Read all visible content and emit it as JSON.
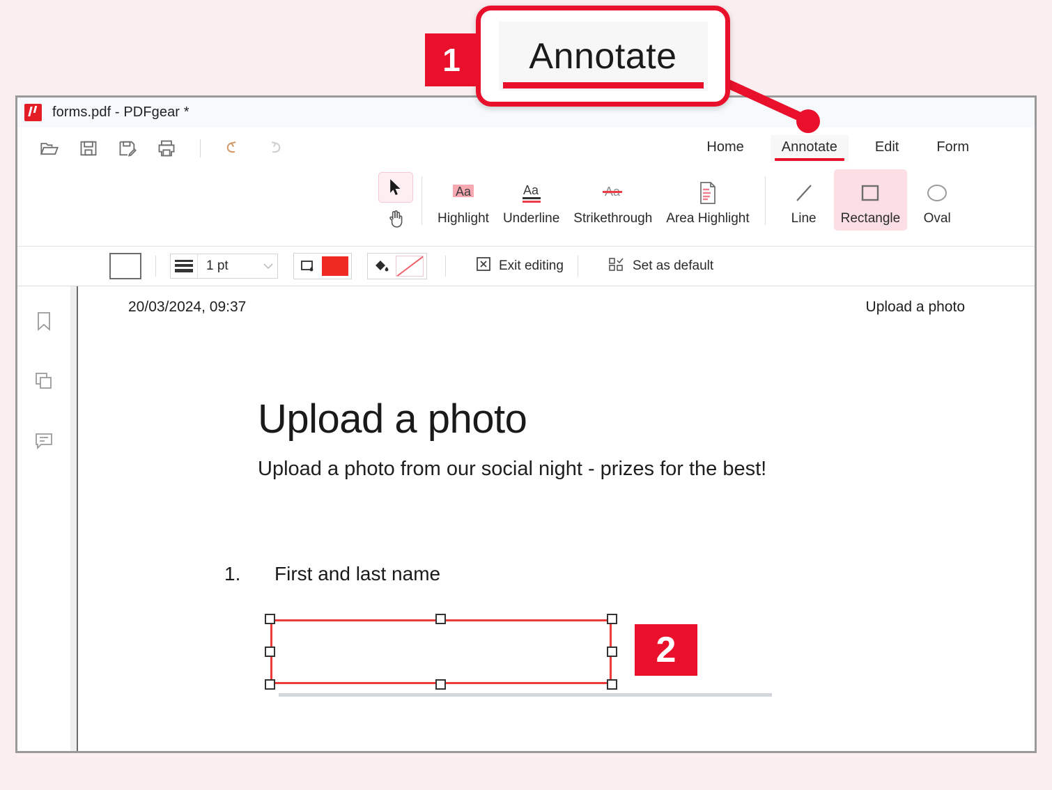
{
  "background_color": "#fbeef1",
  "accent_color": "#e8102a",
  "window": {
    "title": "forms.pdf - PDFgear *",
    "app_icon": "pdfgear-logo-icon"
  },
  "quick_toolbar": {
    "items": [
      {
        "name": "open-file",
        "icon": "folder-open-icon"
      },
      {
        "name": "save",
        "icon": "save-disk-icon"
      },
      {
        "name": "save-as",
        "icon": "save-edit-icon"
      },
      {
        "name": "print",
        "icon": "printer-icon"
      },
      {
        "name": "undo",
        "icon": "undo-arrow-icon"
      },
      {
        "name": "redo",
        "icon": "redo-arrow-icon"
      }
    ]
  },
  "tabs": [
    {
      "label": "Home",
      "active": false
    },
    {
      "label": "Annotate",
      "active": true
    },
    {
      "label": "Edit",
      "active": false
    },
    {
      "label": "Form",
      "active": false
    }
  ],
  "ribbon": {
    "cursor_tool": {
      "label": "",
      "icon": "arrow-cursor-icon",
      "selected": true
    },
    "hand_tool": {
      "label": "",
      "icon": "hand-icon",
      "selected": false
    },
    "tools": [
      {
        "label": "Highlight",
        "icon": "highlight-aa-icon",
        "selected": false
      },
      {
        "label": "Underline",
        "icon": "underline-aa-icon",
        "selected": false
      },
      {
        "label": "Strikethrough",
        "icon": "strikethrough-aa-icon",
        "selected": false
      },
      {
        "label": "Area Highlight",
        "icon": "area-highlight-icon",
        "selected": false
      }
    ],
    "shape_tools": [
      {
        "label": "Line",
        "icon": "line-icon",
        "selected": false
      },
      {
        "label": "Rectangle",
        "icon": "rectangle-icon",
        "selected": true
      },
      {
        "label": "Oval",
        "icon": "oval-icon",
        "selected": false
      }
    ]
  },
  "properties_bar": {
    "shape_preview_icon": "rectangle-preview-icon",
    "thickness_icon": "line-weight-icon",
    "thickness_value": "1 pt",
    "thickness_caret": "chevron-down-icon",
    "border_color_icon": "border-color-icon",
    "border_color": "#ef2a22",
    "fill_color_icon": "fill-bucket-icon",
    "fill_color": "none",
    "exit_editing_label": "Exit editing",
    "exit_editing_icon": "close-x-box-icon",
    "set_default_label": "Set as default",
    "set_default_icon": "set-default-icon"
  },
  "side_rail": [
    {
      "name": "bookmarks",
      "icon": "bookmark-icon"
    },
    {
      "name": "page-thumbnails",
      "icon": "pages-copy-icon"
    },
    {
      "name": "comments",
      "icon": "comment-bubble-icon"
    }
  ],
  "document": {
    "header_left": "20/03/2024, 09:37",
    "header_right": "Upload a photo",
    "title": "Upload a photo",
    "subtitle": "Upload a photo from our social night - prizes for the best!",
    "question_number": "1.",
    "question_text": "First and last name"
  },
  "annotation": {
    "type": "rectangle",
    "stroke_color": "#ef3b38",
    "fill": "none",
    "selected": true,
    "handle_count": 8
  },
  "callouts": [
    {
      "number": "1",
      "zoom_text": "Annotate",
      "points_to": "annotate-tab"
    },
    {
      "number": "2",
      "points_to": "rectangle-annotation"
    }
  ]
}
